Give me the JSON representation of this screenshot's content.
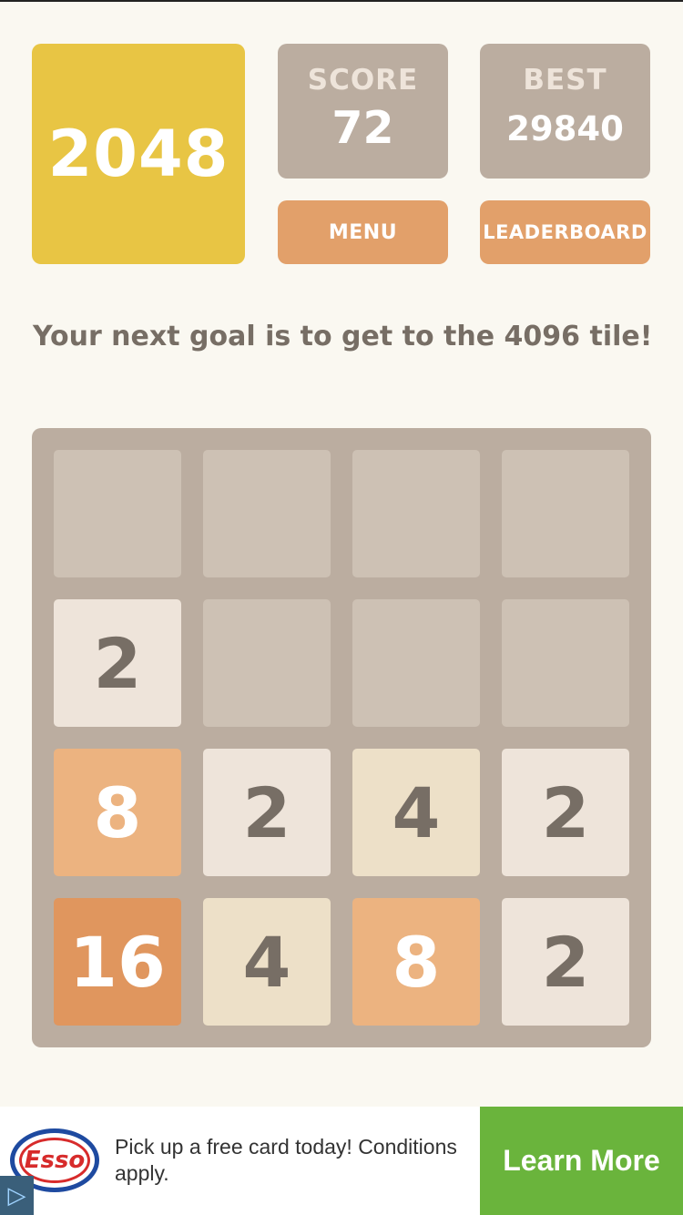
{
  "header": {
    "logo": "2048",
    "score_label": "SCORE",
    "score_value": "72",
    "best_label": "BEST",
    "best_value": "29840",
    "menu_label": "MENU",
    "leaderboard_label": "LEADERBOARD"
  },
  "goal_text": "Your next goal is to get to the 4096 tile!",
  "board": {
    "rows": [
      [
        "",
        "",
        "",
        ""
      ],
      [
        "2",
        "",
        "",
        ""
      ],
      [
        "8",
        "2",
        "4",
        "2"
      ],
      [
        "16",
        "4",
        "8",
        "2"
      ]
    ]
  },
  "ad": {
    "brand": "Esso",
    "text": "Pick up a free card today! Conditions apply.",
    "cta": "Learn More"
  }
}
